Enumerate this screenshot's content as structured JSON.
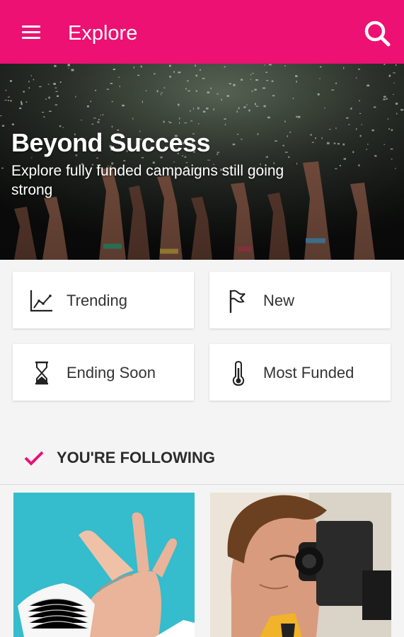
{
  "appbar": {
    "title": "Explore",
    "menu_icon": "hamburger-menu-icon",
    "search_icon": "search-icon",
    "color": "#ec1173"
  },
  "hero": {
    "title": "Beyond Success",
    "subtitle": "Explore fully funded campaigns still going strong"
  },
  "categories": [
    {
      "label": "Trending",
      "icon": "trending-chart-icon"
    },
    {
      "label": "New",
      "icon": "flag-icon"
    },
    {
      "label": "Ending Soon",
      "icon": "hourglass-icon"
    },
    {
      "label": "Most Funded",
      "icon": "thermometer-icon"
    }
  ],
  "following": {
    "label": "YOU'RE FOLLOWING",
    "icon": "check-icon",
    "accent": "#ec1173"
  },
  "campaigns": [
    {
      "image": "hand-holding-white-device"
    },
    {
      "image": "man-looking-through-camera"
    }
  ]
}
